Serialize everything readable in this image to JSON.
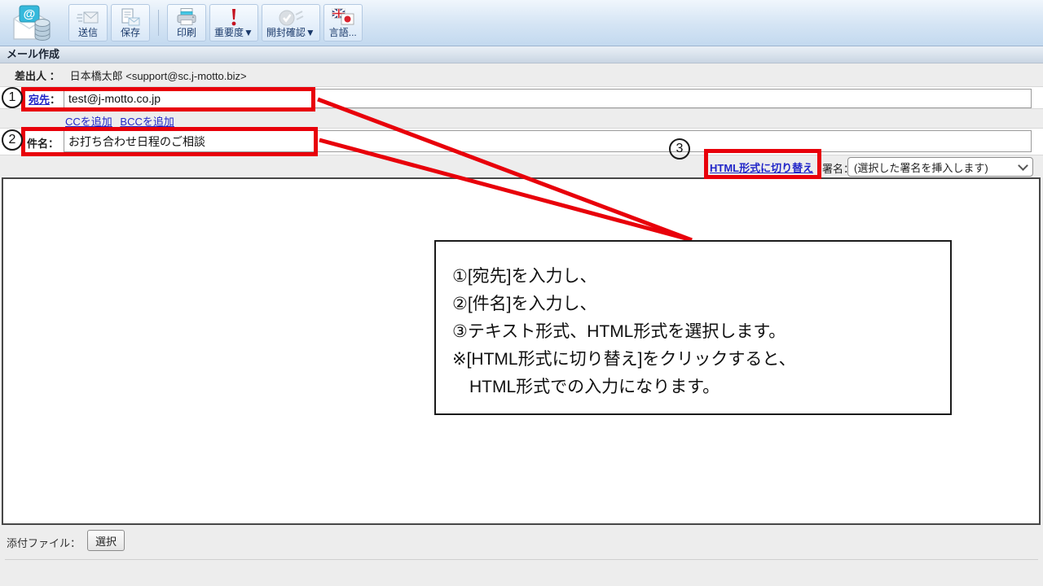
{
  "toolbar": {
    "app_icon": "webmail-compose-app-icon",
    "buttons": [
      {
        "label": "送信",
        "icon": "send-envelope-icon"
      },
      {
        "label": "保存",
        "icon": "save-draft-icon"
      },
      {
        "label": "印刷",
        "icon": "printer-icon"
      },
      {
        "label": "重要度▼",
        "icon": "importance-exclamation-icon"
      },
      {
        "label": "開封確認▼",
        "icon": "read-receipt-check-icon"
      },
      {
        "label": "言語...",
        "icon": "language-flags-icon"
      }
    ]
  },
  "header": {
    "title": "メール作成"
  },
  "compose": {
    "from": {
      "label": "差出人 ：",
      "value": "日本橋太郎 <support@sc.j-motto.biz>"
    },
    "to": {
      "label": "宛先",
      "separator": "：",
      "value": "test@j-motto.co.jp"
    },
    "cc_link": "CCを追加",
    "bcc_link": "BCCを追加",
    "subject": {
      "label": "件名：",
      "value": "お打ち合わせ日程のご相談"
    },
    "format_toggle_link": "HTML形式に切り替え",
    "signature": {
      "label": "署名：",
      "selected_option": "(選択した署名を挿入します)"
    },
    "attachment": {
      "label": "添付ファイル：",
      "select_button": "選択"
    }
  },
  "annotations": {
    "highlight_color": "#e8000a",
    "callouts": [
      {
        "glyph": "①",
        "digit": "1"
      },
      {
        "glyph": "②",
        "digit": "2"
      },
      {
        "glyph": "③",
        "digit": "3"
      }
    ],
    "note_lines": [
      "①[宛先]を入力し、",
      "②[件名]を入力し、",
      "③テキスト形式、HTML形式を選択します。",
      "※[HTML形式に切り替え]をクリックすると、",
      "　HTML形式での入力になります。"
    ]
  }
}
